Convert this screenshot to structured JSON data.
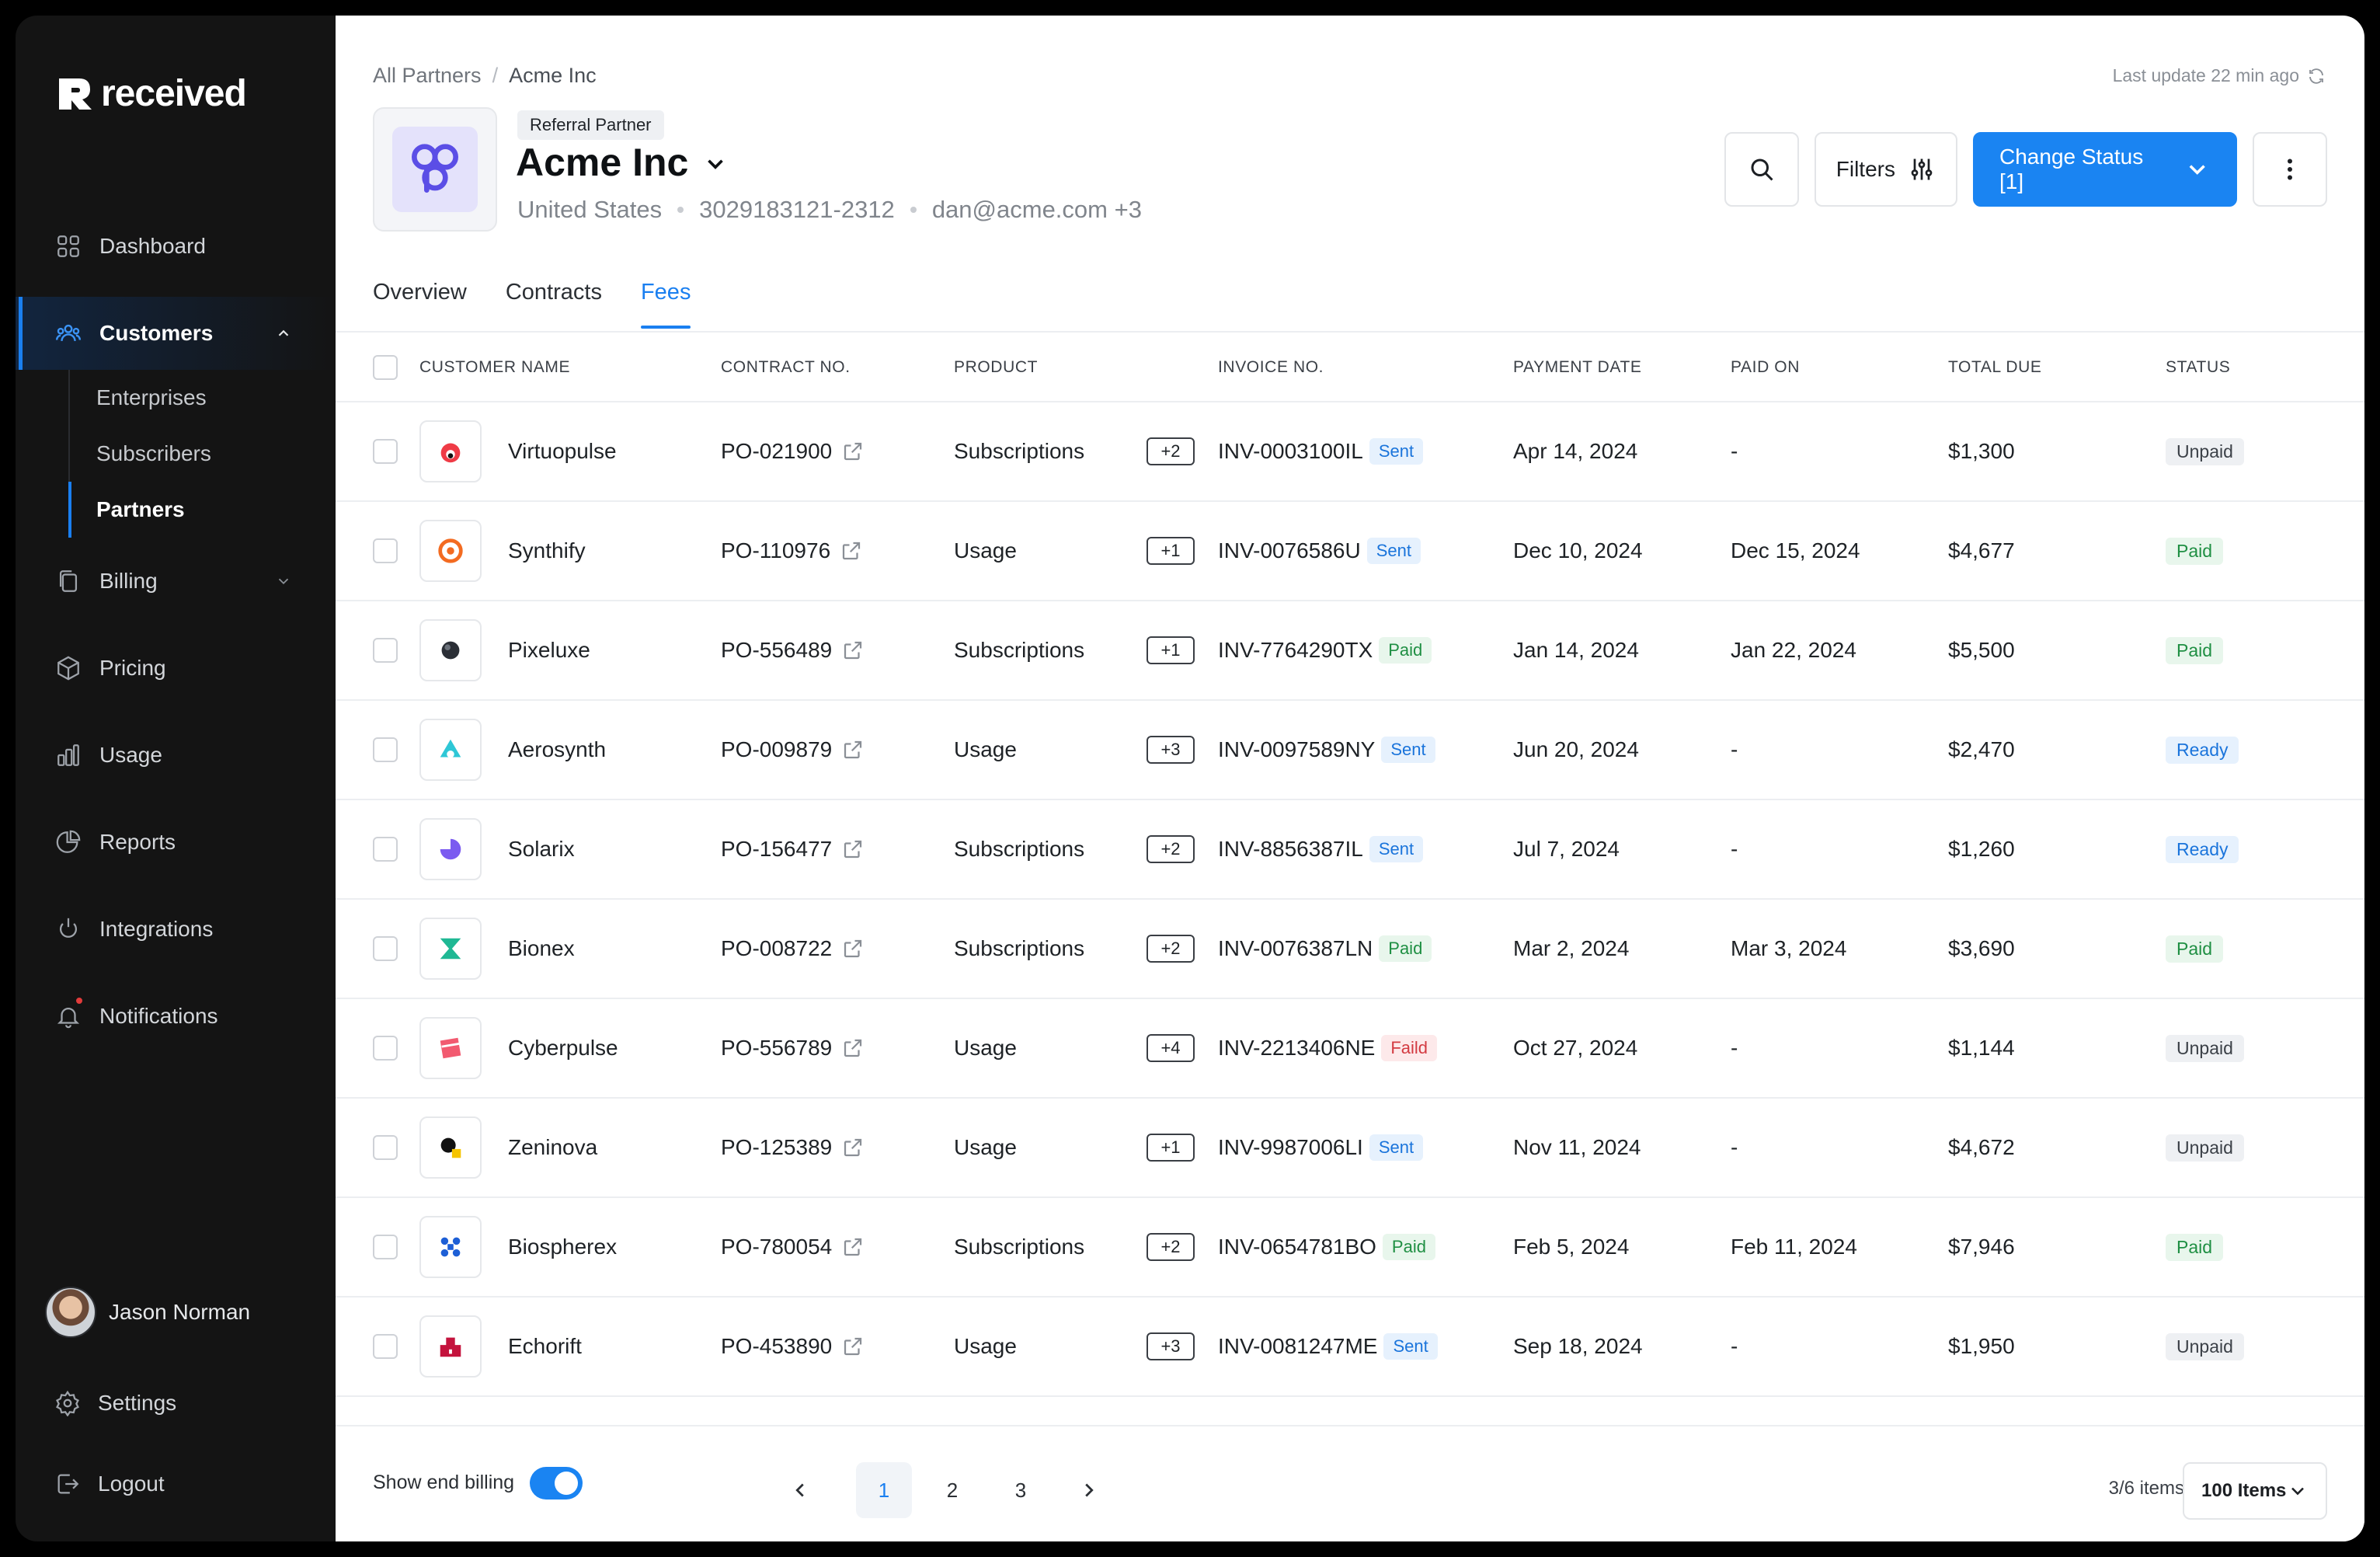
{
  "brand": {
    "name": "received"
  },
  "sidebar": {
    "items": [
      {
        "label": "Dashboard",
        "icon": "grid-icon"
      },
      {
        "label": "Customers",
        "icon": "users-icon",
        "active": true,
        "children": [
          {
            "label": "Enterprises"
          },
          {
            "label": "Subscribers"
          },
          {
            "label": "Partners",
            "active": true
          }
        ]
      },
      {
        "label": "Billing",
        "icon": "copy-icon"
      },
      {
        "label": "Pricing",
        "icon": "box-icon"
      },
      {
        "label": "Usage",
        "icon": "bar-chart-icon"
      },
      {
        "label": "Reports",
        "icon": "pie-chart-icon"
      },
      {
        "label": "Integrations",
        "icon": "plug-icon"
      },
      {
        "label": "Notifications",
        "icon": "bell-icon"
      }
    ],
    "user": {
      "name": "Jason Norman"
    },
    "settings_label": "Settings",
    "logout_label": "Logout"
  },
  "header": {
    "breadcrumb": [
      "All Partners",
      "Acme Inc"
    ],
    "last_update": "Last update 22 min ago",
    "badge": "Referral Partner",
    "title": "Acme Inc",
    "country": "United States",
    "phone": "3029183121-2312",
    "email": "dan@acme.com +3",
    "filters_label": "Filters",
    "change_status_label": "Change Status [1]"
  },
  "tabs": [
    {
      "label": "Overview"
    },
    {
      "label": "Contracts"
    },
    {
      "label": "Fees",
      "active": true
    }
  ],
  "table": {
    "columns": [
      "CUSTOMER NAME",
      "CONTRACT NO.",
      "PRODUCT",
      "INVOICE NO.",
      "PAYMENT DATE",
      "PAID ON",
      "TOTAL DUE",
      "STATUS"
    ],
    "rows": [
      {
        "name": "Virtuopulse",
        "logo": "virtuopulse-logo-icon",
        "contract": "PO-021900",
        "product": "Subscriptions",
        "extra": "+2",
        "invoice": "INV-0003100IL",
        "inv_status": "Sent",
        "payment_date": "Apr 14, 2024",
        "paid_on": "-",
        "total": "$1,300",
        "status": "Unpaid"
      },
      {
        "name": "Synthify",
        "logo": "synthify-logo-icon",
        "contract": "PO-110976",
        "product": "Usage",
        "extra": "+1",
        "invoice": "INV-0076586U",
        "inv_status": "Sent",
        "payment_date": "Dec 10, 2024",
        "paid_on": "Dec 15, 2024",
        "total": "$4,677",
        "status": "Paid"
      },
      {
        "name": "Pixeluxe",
        "logo": "pixeluxe-logo-icon",
        "contract": "PO-556489",
        "product": "Subscriptions",
        "extra": "+1",
        "invoice": "INV-7764290TX",
        "inv_status": "Paid",
        "payment_date": "Jan 14, 2024",
        "paid_on": "Jan 22, 2024",
        "total": "$5,500",
        "status": "Paid"
      },
      {
        "name": "Aerosynth",
        "logo": "aerosynth-logo-icon",
        "contract": "PO-009879",
        "product": "Usage",
        "extra": "+3",
        "invoice": "INV-0097589NY",
        "inv_status": "Sent",
        "payment_date": "Jun 20, 2024",
        "paid_on": "-",
        "total": "$2,470",
        "status": "Ready"
      },
      {
        "name": "Solarix",
        "logo": "solarix-logo-icon",
        "contract": "PO-156477",
        "product": "Subscriptions",
        "extra": "+2",
        "invoice": "INV-8856387IL",
        "inv_status": "Sent",
        "payment_date": "Jul 7, 2024",
        "paid_on": "-",
        "total": "$1,260",
        "status": "Ready"
      },
      {
        "name": "Bionex",
        "logo": "bionex-logo-icon",
        "contract": "PO-008722",
        "product": "Subscriptions",
        "extra": "+2",
        "invoice": "INV-0076387LN",
        "inv_status": "Paid",
        "payment_date": "Mar 2, 2024",
        "paid_on": "Mar 3, 2024",
        "total": "$3,690",
        "status": "Paid"
      },
      {
        "name": "Cyberpulse",
        "logo": "cyberpulse-logo-icon",
        "contract": "PO-556789",
        "product": "Usage",
        "extra": "+4",
        "invoice": "INV-2213406NE",
        "inv_status": "Faild",
        "payment_date": "Oct 27, 2024",
        "paid_on": "-",
        "total": "$1,144",
        "status": "Unpaid"
      },
      {
        "name": "Zeninova",
        "logo": "zeninova-logo-icon",
        "contract": "PO-125389",
        "product": "Usage",
        "extra": "+1",
        "invoice": "INV-9987006LI",
        "inv_status": "Sent",
        "payment_date": "Nov 11, 2024",
        "paid_on": "-",
        "total": "$4,672",
        "status": "Unpaid"
      },
      {
        "name": "Biospherex",
        "logo": "biospherex-logo-icon",
        "contract": "PO-780054",
        "product": "Subscriptions",
        "extra": "+2",
        "invoice": "INV-0654781BO",
        "inv_status": "Paid",
        "payment_date": "Feb 5, 2024",
        "paid_on": "Feb 11, 2024",
        "total": "$7,946",
        "status": "Paid"
      },
      {
        "name": "Echorift",
        "logo": "echorift-logo-icon",
        "contract": "PO-453890",
        "product": "Usage",
        "extra": "+3",
        "invoice": "INV-0081247ME",
        "inv_status": "Sent",
        "payment_date": "Sep 18, 2024",
        "paid_on": "-",
        "total": "$1,950",
        "status": "Unpaid"
      }
    ]
  },
  "footer": {
    "toggle_label": "Show end billing",
    "pages": [
      "1",
      "2",
      "3"
    ],
    "active_page": "1",
    "items_count": "3/6 items",
    "items_per_page": "100 Items"
  },
  "colors": {
    "accent": "#1a84f2",
    "sidebar_bg": "#141414",
    "paid": "#1f8f43",
    "failed": "#d33a41"
  }
}
